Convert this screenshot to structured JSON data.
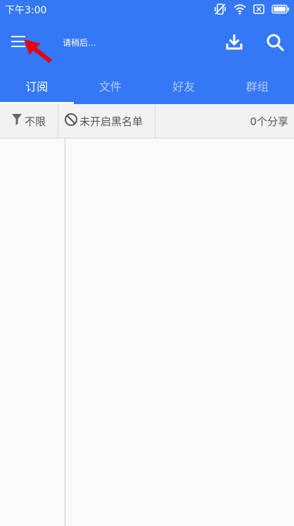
{
  "status_bar": {
    "time": "下午3:00"
  },
  "app_bar": {
    "title": "请稍后..."
  },
  "tabs": [
    {
      "label": "订阅",
      "active": true
    },
    {
      "label": "文件",
      "active": false
    },
    {
      "label": "好友",
      "active": false
    },
    {
      "label": "群组",
      "active": false
    }
  ],
  "filter_bar": {
    "filter_label": "不限",
    "blacklist_label": "未开启黑名单",
    "share_count": "0个分享"
  },
  "colors": {
    "primary": "#3478f6",
    "pointer": "#e8000b"
  }
}
